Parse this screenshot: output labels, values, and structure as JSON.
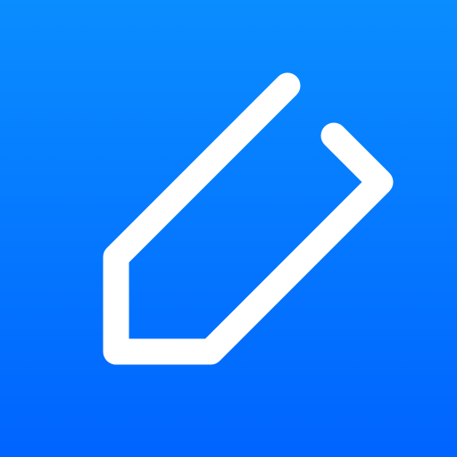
{
  "app_icon": {
    "icon": "pencil-edit-icon",
    "colors": {
      "background_top": "#0a8dff",
      "background_bottom": "#0064ff",
      "glyph": "#ffffff"
    }
  }
}
